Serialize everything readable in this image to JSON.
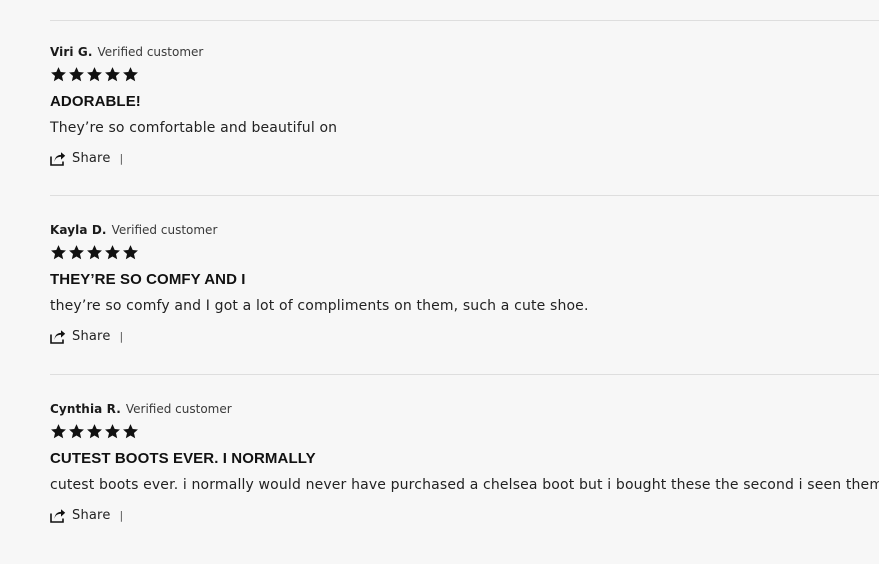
{
  "reviews": [
    {
      "author": "Viri G.",
      "badge": "Verified customer",
      "rating": 5,
      "title": "ADORABLE!",
      "body": "They’re so comfortable and beautiful on",
      "share_label": "Share",
      "separator": "|"
    },
    {
      "author": "Kayla D.",
      "badge": "Verified customer",
      "rating": 5,
      "title": "THEY’RE SO COMFY AND I",
      "body": "they’re so comfy and I got a lot of compliments on them, such a cute shoe.",
      "share_label": "Share",
      "separator": "|"
    },
    {
      "author": "Cynthia R.",
      "badge": "Verified customer",
      "rating": 5,
      "title": "CUTEST BOOTS EVER. I NORMALLY",
      "body": "cutest boots ever. i normally would never have purchased a chelsea boot but i bought these the second i seen them.",
      "share_label": "Share",
      "separator": "|"
    }
  ],
  "icons": {
    "star": "star-icon",
    "share": "share-icon"
  },
  "colors": {
    "background": "#f7f7f7",
    "star": "#111111",
    "divider": "#dedede",
    "text": "#1a1a1a"
  }
}
